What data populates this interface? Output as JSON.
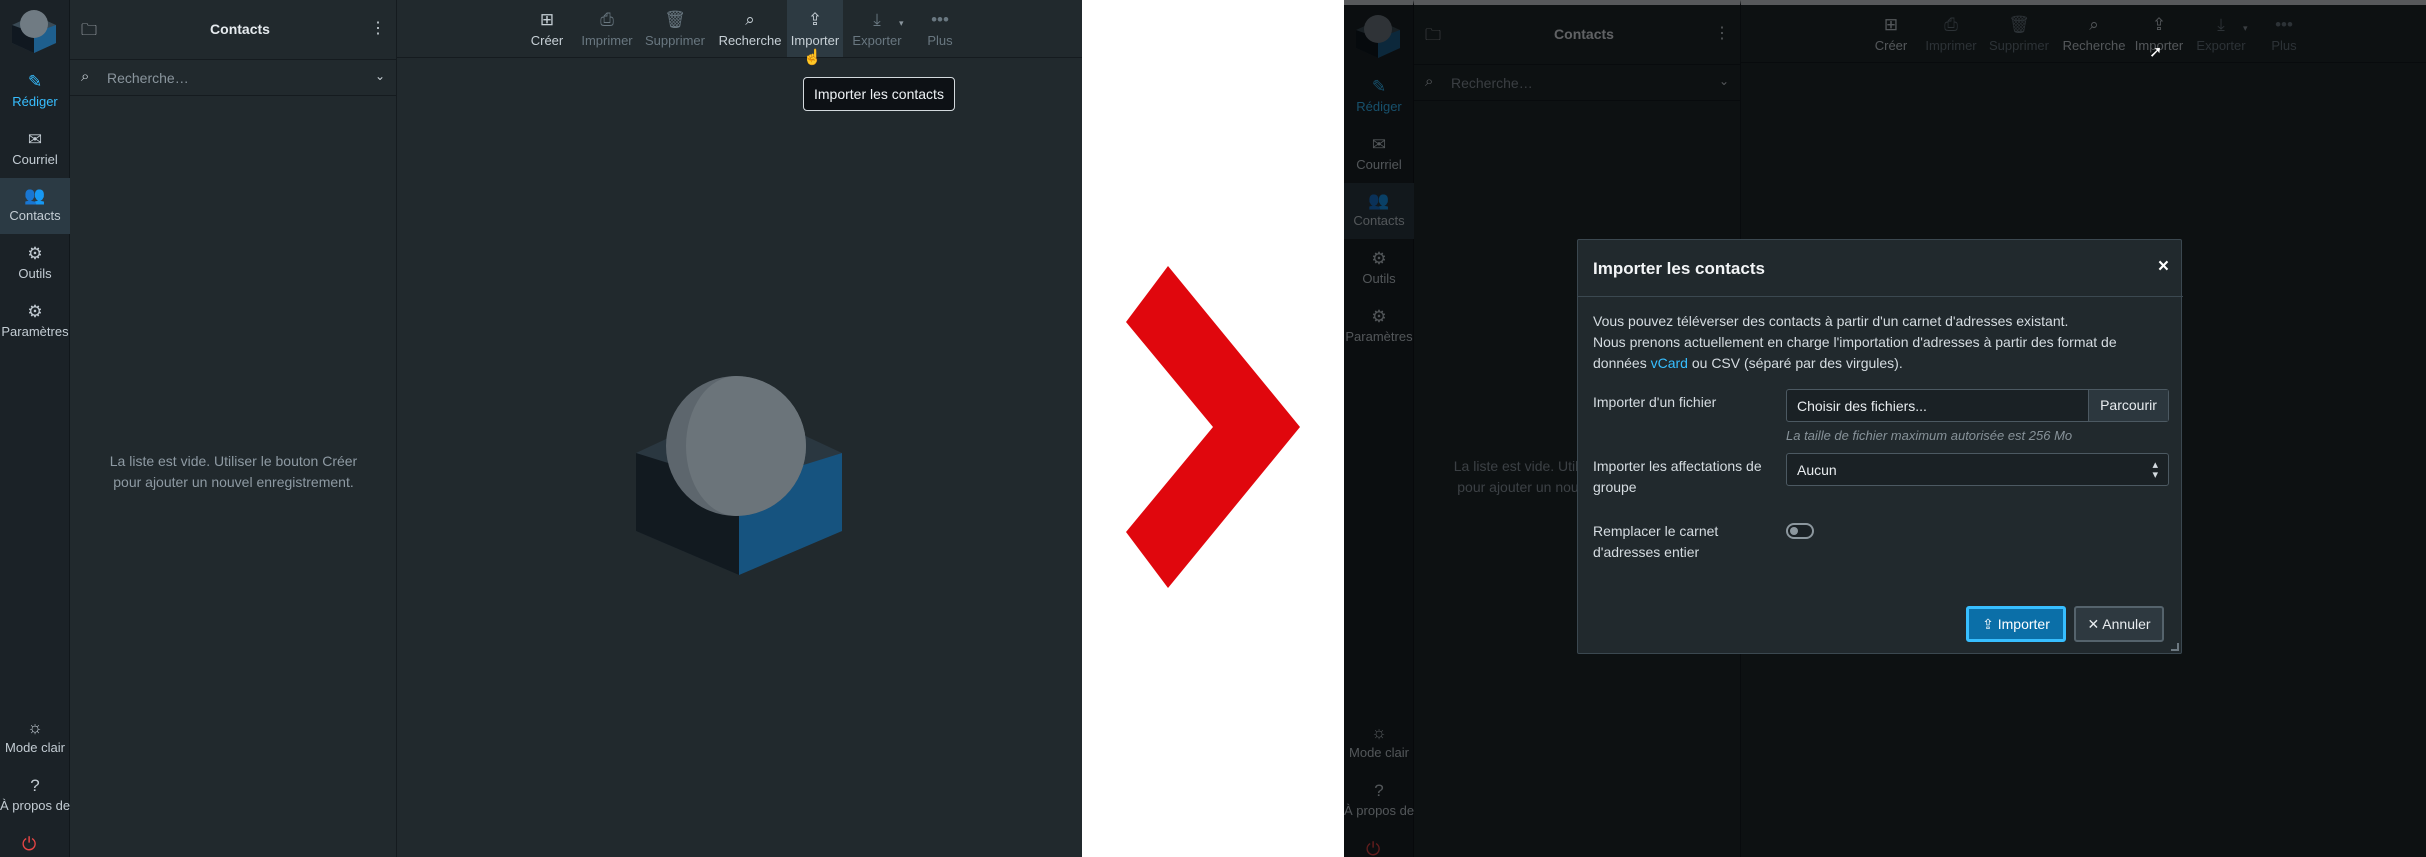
{
  "app": {
    "sidebar": [
      {
        "key": "compose",
        "label": "Rédiger",
        "icon": "compose-icon"
      },
      {
        "key": "mail",
        "label": "Courriel",
        "icon": "envelope-icon"
      },
      {
        "key": "contacts",
        "label": "Contacts",
        "icon": "users-icon"
      },
      {
        "key": "tools",
        "label": "Outils",
        "icon": "gear-icon"
      },
      {
        "key": "settings",
        "label": "Paramètres",
        "icon": "gear-icon"
      }
    ],
    "footer": [
      {
        "key": "light-mode",
        "label": "Mode clair",
        "icon": "sun-icon"
      },
      {
        "key": "about",
        "label": "À propos de",
        "icon": "question-icon"
      }
    ],
    "list_title": "Contacts",
    "search_placeholder": "Recherche…",
    "empty_message": "La liste est vide. Utiliser le bouton Créer pour ajouter un nouvel enregistrement.",
    "toolbar": [
      {
        "key": "create",
        "label": "Créer",
        "icon": "plus-square-icon",
        "enabled": true
      },
      {
        "key": "print",
        "label": "Imprimer",
        "icon": "printer-icon",
        "enabled": false
      },
      {
        "key": "delete",
        "label": "Supprimer",
        "icon": "trash-icon",
        "enabled": false
      },
      {
        "key": "search",
        "label": "Recherche",
        "icon": "search-icon",
        "enabled": true
      },
      {
        "key": "import",
        "label": "Importer",
        "icon": "upload-icon",
        "enabled": true
      },
      {
        "key": "export",
        "label": "Exporter",
        "icon": "download-icon",
        "enabled": false
      },
      {
        "key": "more",
        "label": "Plus",
        "icon": "more-icon",
        "enabled": false
      }
    ],
    "tooltip": "Importer les contacts"
  },
  "dialog": {
    "title": "Importer les contacts",
    "intro_1": "Vous pouvez téléverser des contacts à partir d'un carnet d'adresses existant.",
    "intro_2": "Nous prenons actuellement en charge l'importation d'adresses à partir des format de données",
    "intro_link": "vCard",
    "intro_3": "ou CSV (séparé par des virgules).",
    "file_label": "Importer d'un fichier",
    "file_placeholder": "Choisir des fichiers...",
    "browse_label": "Parcourir",
    "file_hint": "La taille de fichier maximum autorisée est 256 Mo",
    "group_label": "Importer les affectations de groupe",
    "group_value": "Aucun",
    "replace_label": "Remplacer le carnet d'adresses entier",
    "replace_enabled": false,
    "import_button": "Importer",
    "cancel_button": "Annuler"
  },
  "colors": {
    "accent": "#37beff",
    "primary_button": "#0b6fa8",
    "background": "#21292d",
    "arrow": "#e0070d"
  }
}
